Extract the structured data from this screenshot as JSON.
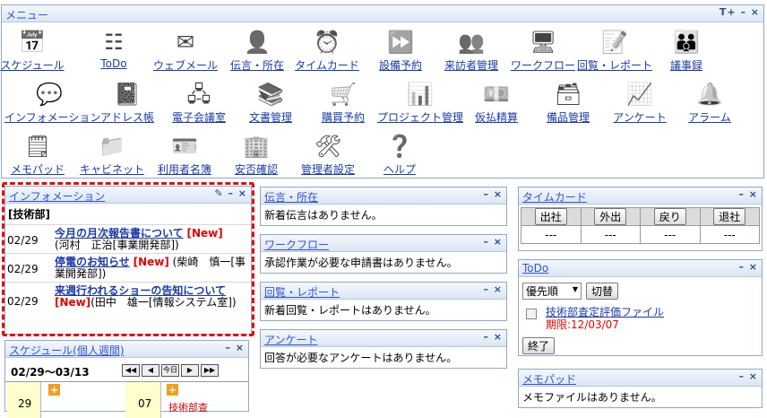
{
  "menu": {
    "title": "メニュー",
    "controls": "T+ – ×",
    "items": [
      {
        "label": "スケジュール",
        "icon": "calendar-icon"
      },
      {
        "label": "ToDo",
        "icon": "todo-list-icon"
      },
      {
        "label": "ウェブメール",
        "icon": "envelope-icon"
      },
      {
        "label": "伝言・所在",
        "icon": "person-icon"
      },
      {
        "label": "タイムカード",
        "icon": "alarm-clock-icon"
      },
      {
        "label": "設備予約",
        "icon": "arrows-icon"
      },
      {
        "label": "来訪者管理",
        "icon": "visitor-icon"
      },
      {
        "label": "ワークフロー",
        "icon": "workflow-icon"
      },
      {
        "label": "回覧・レポート",
        "icon": "report-icon"
      },
      {
        "label": "議事録",
        "icon": "meeting-people-icon"
      },
      {
        "label": "インフォメーション",
        "icon": "speech-bubble-icon"
      },
      {
        "label": "アドレス帳",
        "icon": "address-book-icon"
      },
      {
        "label": "電子会議室",
        "icon": "conference-icon"
      },
      {
        "label": "文書管理",
        "icon": "binders-icon"
      },
      {
        "label": "購買予約",
        "icon": "shopping-cart-icon"
      },
      {
        "label": "プロジェクト管理",
        "icon": "gantt-icon"
      },
      {
        "label": "仮払精算",
        "icon": "register-icon"
      },
      {
        "label": "備品管理",
        "icon": "equipment-icon"
      },
      {
        "label": "アンケート",
        "icon": "survey-chart-icon"
      },
      {
        "label": "アラーム",
        "icon": "bell-icon"
      },
      {
        "label": "メモパッド",
        "icon": "memo-pad-icon"
      },
      {
        "label": "キャビネット",
        "icon": "folder-icon"
      },
      {
        "label": "利用者名簿",
        "icon": "id-card-icon"
      },
      {
        "label": "安否確認",
        "icon": "building-icon"
      },
      {
        "label": "管理者設定",
        "icon": "admin-tools-icon"
      },
      {
        "label": "ヘルプ",
        "icon": "help-icon"
      }
    ]
  },
  "information": {
    "title": "インフォメーション",
    "controls": "– ×",
    "dept": "[技術部]",
    "items": [
      {
        "date": "02/29",
        "title": "今月の月次報告書について",
        "new": "[New]",
        "author": "(河村　正治[事業開発部])"
      },
      {
        "date": "02/29",
        "title": "停電のお知らせ",
        "new": "[New]",
        "author": "(柴崎　慎一[事業開発部])"
      },
      {
        "date": "02/29",
        "title": "来週行われるショーの告知について",
        "new": "[New]",
        "author": "(田中　雄一[情報システム室])"
      }
    ]
  },
  "schedule": {
    "title": "スケジュール(個人週間)",
    "controls": "– ×",
    "range": "02/29～03/13",
    "nav": [
      "◀◀",
      "◀",
      "今日",
      "▶",
      "▶▶"
    ],
    "day1": "29",
    "day2": "07",
    "entry": "技術部査"
  },
  "dengon": {
    "title": "伝言・所在",
    "controls": "– ×",
    "message": "新着伝言はありません。"
  },
  "workflow": {
    "title": "ワークフロー",
    "controls": "– ×",
    "message": "承認作業が必要な申請書はありません。"
  },
  "circular": {
    "title": "回覧・レポート",
    "controls": "– ×",
    "message": "新着回覧・レポートはありません。"
  },
  "survey": {
    "title": "アンケート",
    "controls": "– ×",
    "message": "回答が必要なアンケートはありません。"
  },
  "timecard": {
    "title": "タイムカード",
    "controls": "– ×",
    "buttons": [
      "出社",
      "外出",
      "戻り",
      "退社"
    ],
    "values": [
      "---",
      "---",
      "---",
      "---"
    ]
  },
  "todo": {
    "title": "ToDo",
    "controls": "– ×",
    "sort": "優先順",
    "switch": "切替",
    "task": "技術部査定評価ファイル",
    "due": "期限:12/03/07",
    "done": "終了"
  },
  "memopad": {
    "title": "メモパッド",
    "controls": "– ×",
    "message": "メモファイルはありません。"
  }
}
